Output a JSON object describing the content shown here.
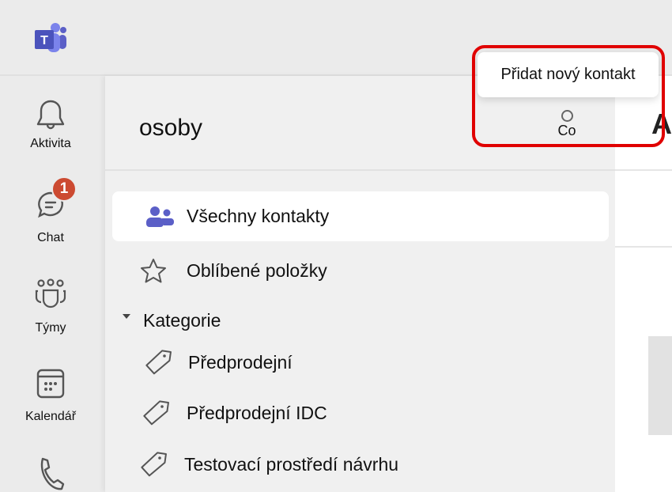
{
  "app": {
    "logo": "microsoft-teams-logo"
  },
  "rail": {
    "items": [
      {
        "label": "Aktivita",
        "icon": "bell-icon"
      },
      {
        "label": "Chat",
        "icon": "chat-icon",
        "badge": "1"
      },
      {
        "label": "Týmy",
        "icon": "teams-icon"
      },
      {
        "label": "Kalendář",
        "icon": "calendar-icon"
      },
      {
        "label": "",
        "icon": "phone-icon"
      }
    ]
  },
  "panel": {
    "title": "osoby",
    "add_contact": {
      "tooltip": "Přidat nový kontakt",
      "label": "Co"
    },
    "items": [
      {
        "label": "Všechny kontakty",
        "icon": "people-icon",
        "selected": true
      },
      {
        "label": "Oblíbené položky",
        "icon": "star-icon"
      }
    ],
    "category_header": "Kategorie",
    "categories": [
      {
        "label": "Předprodejní",
        "icon": "tag-icon"
      },
      {
        "label": "Předprodejní IDC",
        "icon": "tag-icon"
      },
      {
        "label": "Testovací prostředí návrhu",
        "icon": "tag-icon"
      }
    ]
  },
  "right": {
    "heading_initial": "A"
  },
  "colors": {
    "accent": "#5b5fc7",
    "badge": "#cc4a31",
    "highlight": "#e00000"
  }
}
